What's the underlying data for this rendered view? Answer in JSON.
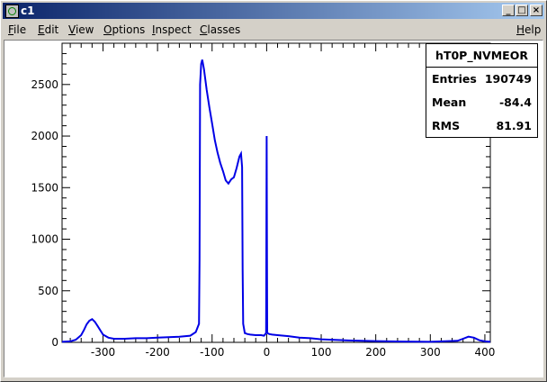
{
  "window": {
    "title": "c1",
    "buttons": {
      "minimize": "_",
      "restore": "□",
      "close": "×"
    }
  },
  "menubar": {
    "items": [
      {
        "label_prefix": "F",
        "label_rest": "ile"
      },
      {
        "label_prefix": "E",
        "label_rest": "dit"
      },
      {
        "label_prefix": "V",
        "label_rest": "iew"
      },
      {
        "label_prefix": "O",
        "label_rest": "ptions"
      },
      {
        "label_prefix": "I",
        "label_rest": "nspect"
      },
      {
        "label_prefix": "C",
        "label_rest": "lasses"
      }
    ],
    "help": {
      "label_prefix": "H",
      "label_rest": "elp"
    }
  },
  "stats": {
    "name": "hT0P_NVMEOR",
    "entries_label": "Entries",
    "entries_value": "190749",
    "mean_label": "Mean",
    "mean_value": "-84.4",
    "rms_label": "RMS",
    "rms_value": "81.91"
  },
  "colors": {
    "line": "#0000e6",
    "titlebar_start": "#0a246a",
    "titlebar_end": "#a6caf0",
    "window_bg": "#d4d0c8"
  },
  "chart_data": {
    "type": "line",
    "title": "",
    "xlabel": "",
    "ylabel": "",
    "xlim": [
      -375,
      410
    ],
    "ylim": [
      0,
      2900
    ],
    "xticks": [
      -300,
      -200,
      -100,
      0,
      100,
      200,
      300,
      400
    ],
    "yticks": [
      0,
      500,
      1000,
      1500,
      2000,
      2500
    ],
    "grid": false,
    "series": [
      {
        "x": [
          -375,
          -360,
          -350,
          -340,
          -335,
          -330,
          -325,
          -320,
          -315,
          -310,
          -300,
          -290,
          -280,
          -260,
          -240,
          -220,
          -200,
          -180,
          -160,
          -140,
          -130,
          -124,
          -123,
          -122,
          -120,
          -118,
          -115,
          -110,
          -105,
          -100,
          -95,
          -90,
          -85,
          -80,
          -75,
          -70,
          -65,
          -60,
          -55,
          -50,
          -47,
          -45,
          -44,
          -43,
          -40,
          -35,
          -30,
          -20,
          -10,
          -5,
          -1,
          0,
          1,
          5,
          10,
          20,
          40,
          60,
          80,
          100,
          120,
          150,
          200,
          250,
          300,
          350,
          360,
          370,
          380,
          390,
          400,
          410
        ],
        "y": [
          5,
          10,
          25,
          70,
          120,
          175,
          210,
          225,
          200,
          160,
          75,
          45,
          35,
          35,
          40,
          40,
          45,
          50,
          55,
          65,
          100,
          180,
          800,
          2500,
          2700,
          2740,
          2650,
          2450,
          2280,
          2120,
          1960,
          1840,
          1740,
          1660,
          1570,
          1540,
          1580,
          1600,
          1690,
          1800,
          1830,
          1700,
          700,
          180,
          90,
          80,
          75,
          70,
          70,
          65,
          90,
          2000,
          90,
          80,
          75,
          70,
          60,
          45,
          40,
          30,
          25,
          18,
          12,
          8,
          5,
          15,
          35,
          55,
          45,
          20,
          10,
          5
        ]
      }
    ]
  }
}
